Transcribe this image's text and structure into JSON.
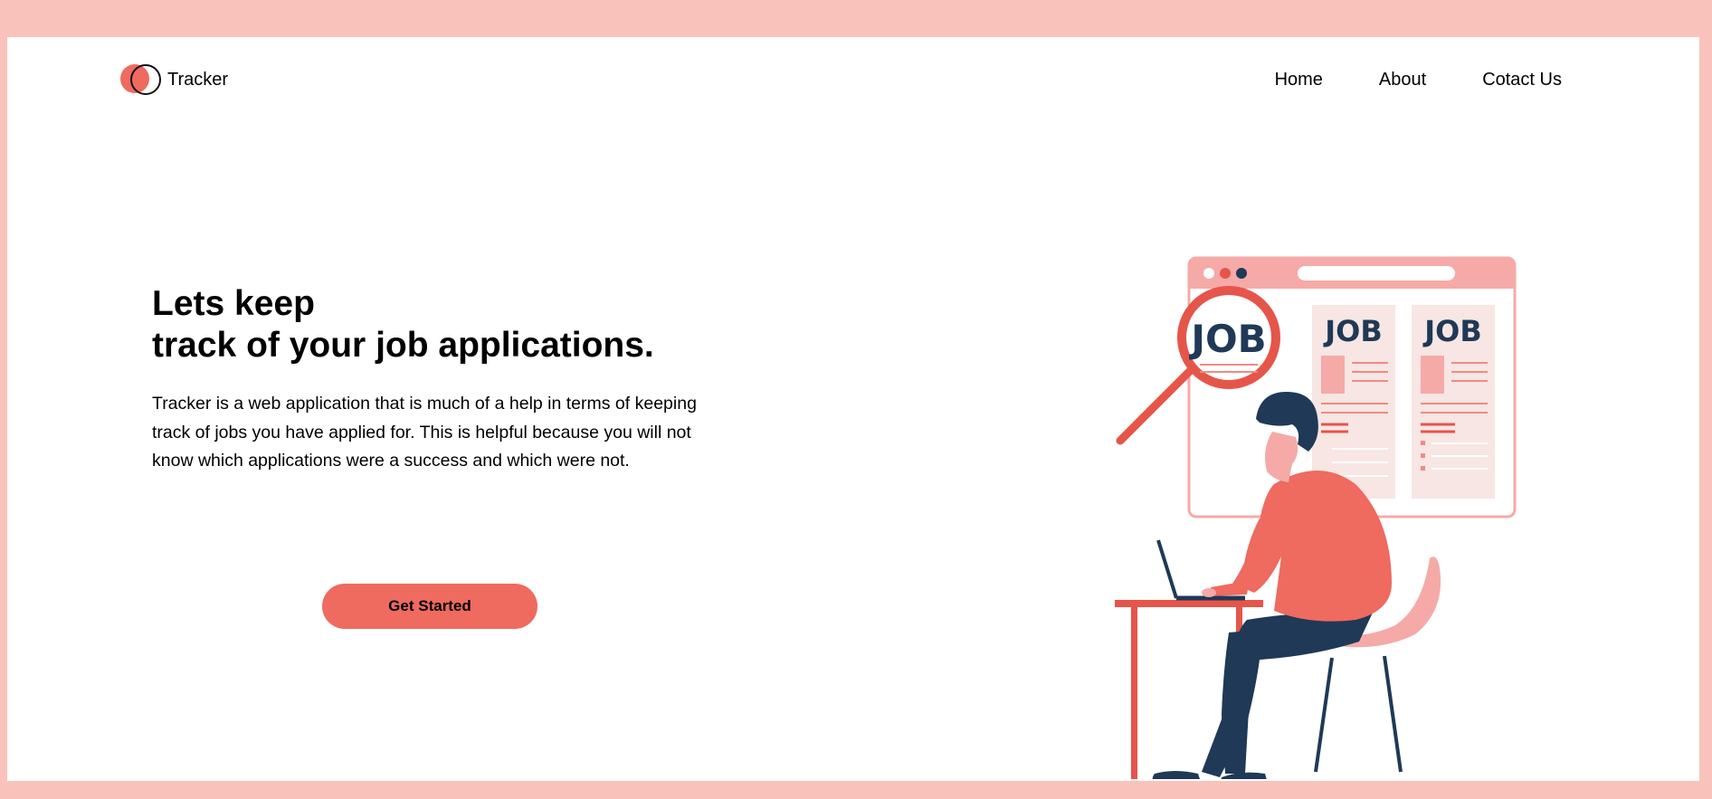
{
  "brand": {
    "name": "Tracker"
  },
  "nav": {
    "items": [
      {
        "label": "Home"
      },
      {
        "label": "About"
      },
      {
        "label": "Cotact Us"
      }
    ]
  },
  "hero": {
    "title_line1": "Lets keep",
    "title_line2": "track of your job applications.",
    "description": "Tracker is a web application that is much of a help in terms of keeping track of jobs you have applied for. This is helpful because you will not know which applications were a success and which were not.",
    "cta_label": "Get Started"
  },
  "illustration": {
    "magnifier_text": "JOB",
    "card1_text": "JOB",
    "card2_text": "JOB"
  },
  "colors": {
    "frame": "#f9c3bb",
    "accent": "#ef6a5f",
    "navy": "#1f3957",
    "pink": "#f5aaa8"
  }
}
